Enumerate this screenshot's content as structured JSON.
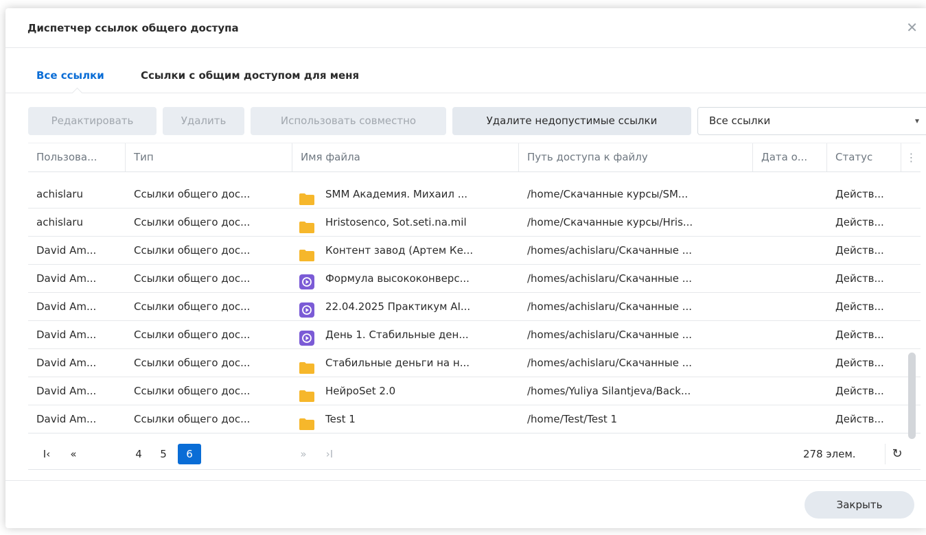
{
  "dialog": {
    "title": "Диспетчер ссылок общего доступа",
    "close_glyph": "✕",
    "close_button_label": "Закрыть"
  },
  "tabs": [
    {
      "label": "Все ссылки",
      "active": true
    },
    {
      "label": "Ссылки с общим доступом для меня",
      "active": false
    }
  ],
  "toolbar": {
    "edit_label": "Редактировать",
    "delete_label": "Удалить",
    "share_label": "Использовать совместно",
    "remove_invalid_label": "Удалите недопустимые ссылки",
    "filter_value": "Все ссылки",
    "filter_arrow": "▾"
  },
  "table": {
    "columns": [
      "Пользова...",
      "Тип",
      "Имя файла",
      "Путь доступа к файлу",
      "Дата о...",
      "Статус"
    ],
    "column_menu_glyph": "⋮",
    "rows": [
      {
        "user": "achislaru",
        "type": "Ссылки общего дос...",
        "icon": "folder-icon",
        "name": "SMM Академия. Михаил ...",
        "path": "/home/Скачанные курсы/SM...",
        "date": "",
        "status": "Действ..."
      },
      {
        "user": "achislaru",
        "type": "Ссылки общего дос...",
        "icon": "folder-icon",
        "name": "Hristosenco, Sot.seti.na.mil",
        "path": "/home/Скачанные курсы/Hris...",
        "date": "",
        "status": "Действ..."
      },
      {
        "user": "David Am...",
        "type": "Ссылки общего дос...",
        "icon": "folder-icon",
        "name": "Контент завод (Артем Ке...",
        "path": "/homes/achislaru/Скачанные ...",
        "date": "",
        "status": "Действ..."
      },
      {
        "user": "David Am...",
        "type": "Ссылки общего дос...",
        "icon": "video-file-icon",
        "name": "Формула высококонверс...",
        "path": "/homes/achislaru/Скачанные ...",
        "date": "",
        "status": "Действ..."
      },
      {
        "user": "David Am...",
        "type": "Ссылки общего дос...",
        "icon": "video-file-icon",
        "name": "22.04.2025 Практикум AI...",
        "path": "/homes/achislaru/Скачанные ...",
        "date": "",
        "status": "Действ..."
      },
      {
        "user": "David Am...",
        "type": "Ссылки общего дос...",
        "icon": "video-file-icon",
        "name": "День 1. Стабильные ден...",
        "path": "/homes/achislaru/Скачанные ...",
        "date": "",
        "status": "Действ..."
      },
      {
        "user": "David Am...",
        "type": "Ссылки общего дос...",
        "icon": "folder-icon",
        "name": "Стабильные деньги на н...",
        "path": "/homes/achislaru/Скачанные ...",
        "date": "",
        "status": "Действ..."
      },
      {
        "user": "David Am...",
        "type": "Ссылки общего дос...",
        "icon": "folder-icon",
        "name": "НейроSet 2.0",
        "path": "/homes/Yuliya Silantjeva/Back...",
        "date": "",
        "status": "Действ..."
      },
      {
        "user": "David Am...",
        "type": "Ссылки общего дос...",
        "icon": "folder-icon",
        "name": "Test 1",
        "path": "/home/Test/Test 1",
        "date": "",
        "status": "Действ..."
      }
    ]
  },
  "pager": {
    "first_glyph": "I‹",
    "prev_glyph": "«",
    "pages": [
      "4",
      "5",
      "6"
    ],
    "current_page": "6",
    "next_glyph": "»",
    "last_glyph": "›I",
    "count": "278 элем.",
    "refresh_glyph": "↻"
  },
  "colors": {
    "accent": "#0a6dd6",
    "folder": "#f6b72c",
    "video": "#7b5bd6"
  }
}
